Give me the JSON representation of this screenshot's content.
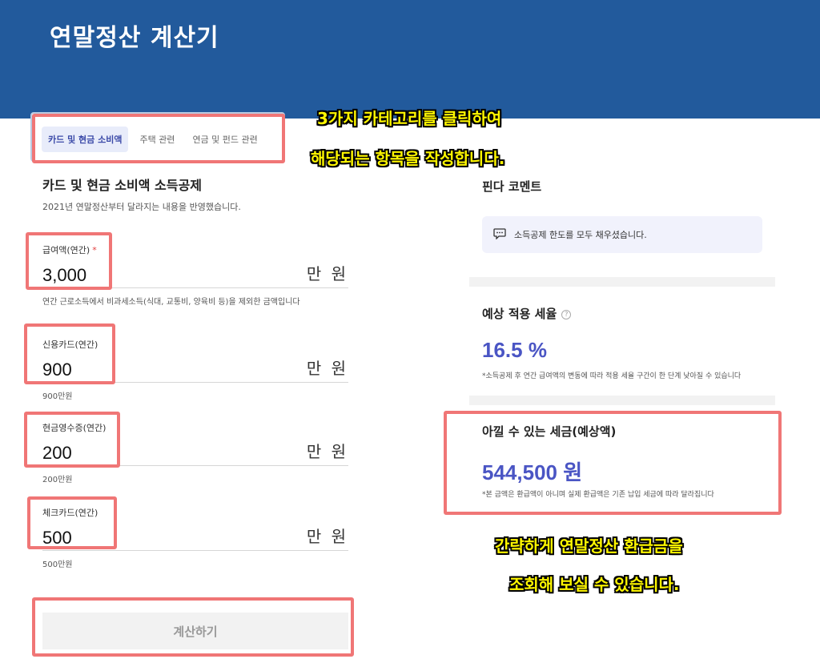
{
  "header": {
    "title": "연말정산 계산기"
  },
  "tabs": [
    {
      "label": "카드 및 현금 소비액"
    },
    {
      "label": "주택 관련"
    },
    {
      "label": "연금 및 펀드 관련"
    }
  ],
  "section": {
    "title": "카드 및 현금 소비액 소득공제",
    "subtitle": "2021년 연말정산부터 달라지는 내용을 반영했습니다."
  },
  "fields": {
    "salary": {
      "label": "급여액(연간)",
      "required_mark": "*",
      "value": "3,000",
      "unit": "만 원",
      "hint": "연간 근로소득에서 비과세소득(식대, 교통비, 양육비 등)을 제외한 금액입니다"
    },
    "credit": {
      "label": "신용카드(연간)",
      "value": "900",
      "unit": "만 원",
      "hint": "900만원"
    },
    "cash": {
      "label": "현금영수증(연간)",
      "value": "200",
      "unit": "만 원",
      "hint": "200만원"
    },
    "check": {
      "label": "체크카드(연간)",
      "value": "500",
      "unit": "만 원",
      "hint": "500만원"
    }
  },
  "calc_button": "계산하기",
  "callouts": {
    "top_line1": "3가지 카테고리를 클릭하여",
    "top_line2": "해당되는 항목을 작성합니다.",
    "bottom_line1": "간략하게 연말정산 환급금을",
    "bottom_line2": "조회해 보실 수 있습니다."
  },
  "right": {
    "comment_title": "핀다 코멘트",
    "comment_text": "소득공제 한도를 모두 채우셨습니다.",
    "rate_title": "예상 적용 세율",
    "rate_help": "?",
    "rate_value": "16.5 %",
    "rate_note": "*소득공제 후 연간 급여액의 변동에 따라 적용 세율 구간이 한 단계 낮아질 수 있습니다",
    "saving_title": "아낄 수 있는 세금(예상액)",
    "saving_value": "544,500 원",
    "saving_note": "*본 금액은 환급액이 아니며 실제 환급액은 기존 납입 세금에 따라 달라집니다"
  },
  "colors": {
    "header_bg": "#225a9c",
    "accent_blue": "#4a55c4",
    "highlight_border": "#f07676",
    "callout_text": "#fff700"
  }
}
